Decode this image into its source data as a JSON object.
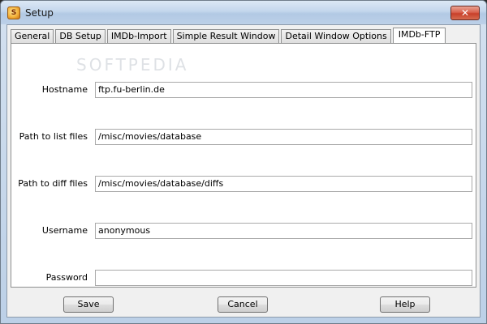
{
  "window": {
    "title": "Setup",
    "close_label": "✕",
    "icon_glyph": "S"
  },
  "tabs": [
    {
      "label": "General",
      "active": false
    },
    {
      "label": "DB Setup",
      "active": false
    },
    {
      "label": "IMDb-Import",
      "active": false
    },
    {
      "label": "Simple Result Window",
      "active": false
    },
    {
      "label": "Detail Window Options",
      "active": false
    },
    {
      "label": "IMDb-FTP",
      "active": true
    }
  ],
  "watermark": "SOFTPEDIA",
  "form": {
    "hostname": {
      "label": "Hostname",
      "value": "ftp.fu-berlin.de"
    },
    "path_list": {
      "label": "Path to list files",
      "value": "/misc/movies/database"
    },
    "path_diff": {
      "label": "Path to diff files",
      "value": "/misc/movies/database/diffs"
    },
    "username": {
      "label": "Username",
      "value": "anonymous"
    },
    "password": {
      "label": "Password",
      "value": ""
    }
  },
  "buttons": {
    "save": "Save",
    "cancel": "Cancel",
    "help": "Help"
  }
}
